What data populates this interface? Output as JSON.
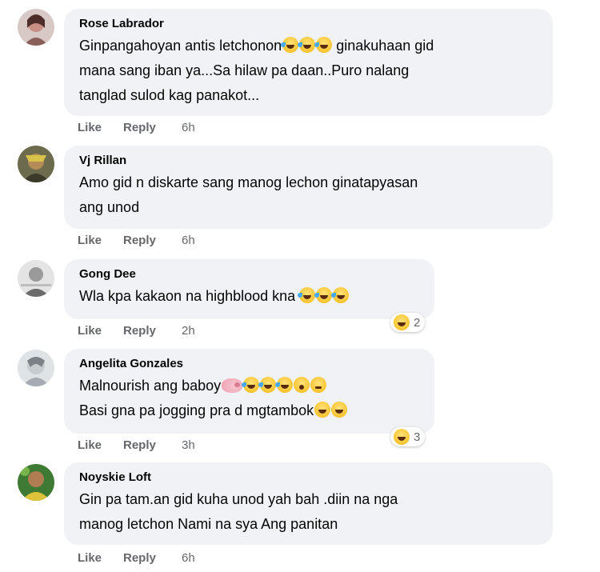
{
  "comments": [
    {
      "author": "Rose Labrador",
      "lines": [
        "Ginpangahoyan antis letchonon           ginakuhaan gid",
        "mana sang iban ya...Sa hilaw pa daan..Puro nalang",
        "tanglad sulod kag panakot..."
      ],
      "actions": {
        "like": "Like",
        "reply": "Reply",
        "time": "6h"
      }
    },
    {
      "author": "Vj Rillan",
      "lines": [
        "Amo gid n diskarte sang manog lechon ginatapyasan",
        "ang unod"
      ],
      "actions": {
        "like": "Like",
        "reply": "Reply",
        "time": "6h"
      }
    },
    {
      "author": "Gong Dee",
      "lines": [
        "Wla kpa kakaon na highblood kna"
      ],
      "actions": {
        "like": "Like",
        "reply": "Reply",
        "time": "2h"
      },
      "reaction_count": "2"
    },
    {
      "author": "Angelita Gonzales",
      "lines": [
        "Malnourish ang baboy",
        "Basi gna pa jogging pra d mgtambok"
      ],
      "actions": {
        "like": "Like",
        "reply": "Reply",
        "time": "3h"
      },
      "reaction_count": "3"
    },
    {
      "author": "Noyskie Loft",
      "lines": [
        "Gin pa tam.an gid kuha unod yah bah .diin na nga",
        "manog letchon Nami na sya Ang panitan"
      ],
      "actions": {
        "like": "Like",
        "reply": "Reply",
        "time": "6h"
      }
    }
  ],
  "icons": {
    "laugh_emoji": "laughing-tears-emoji",
    "rofl_emoji": "rolling-on-floor-laughing-emoji",
    "pig_emoji": "pig-nose-emoji",
    "wow_emoji": "astonished-emoji",
    "think_emoji": "thinking-face-emoji",
    "haha_reaction": "haha-reaction-icon"
  },
  "colors": {
    "bubble_bg": "#f0f2f5",
    "meta_text": "#65676b",
    "emoji_yellow": "#f7c42f"
  }
}
